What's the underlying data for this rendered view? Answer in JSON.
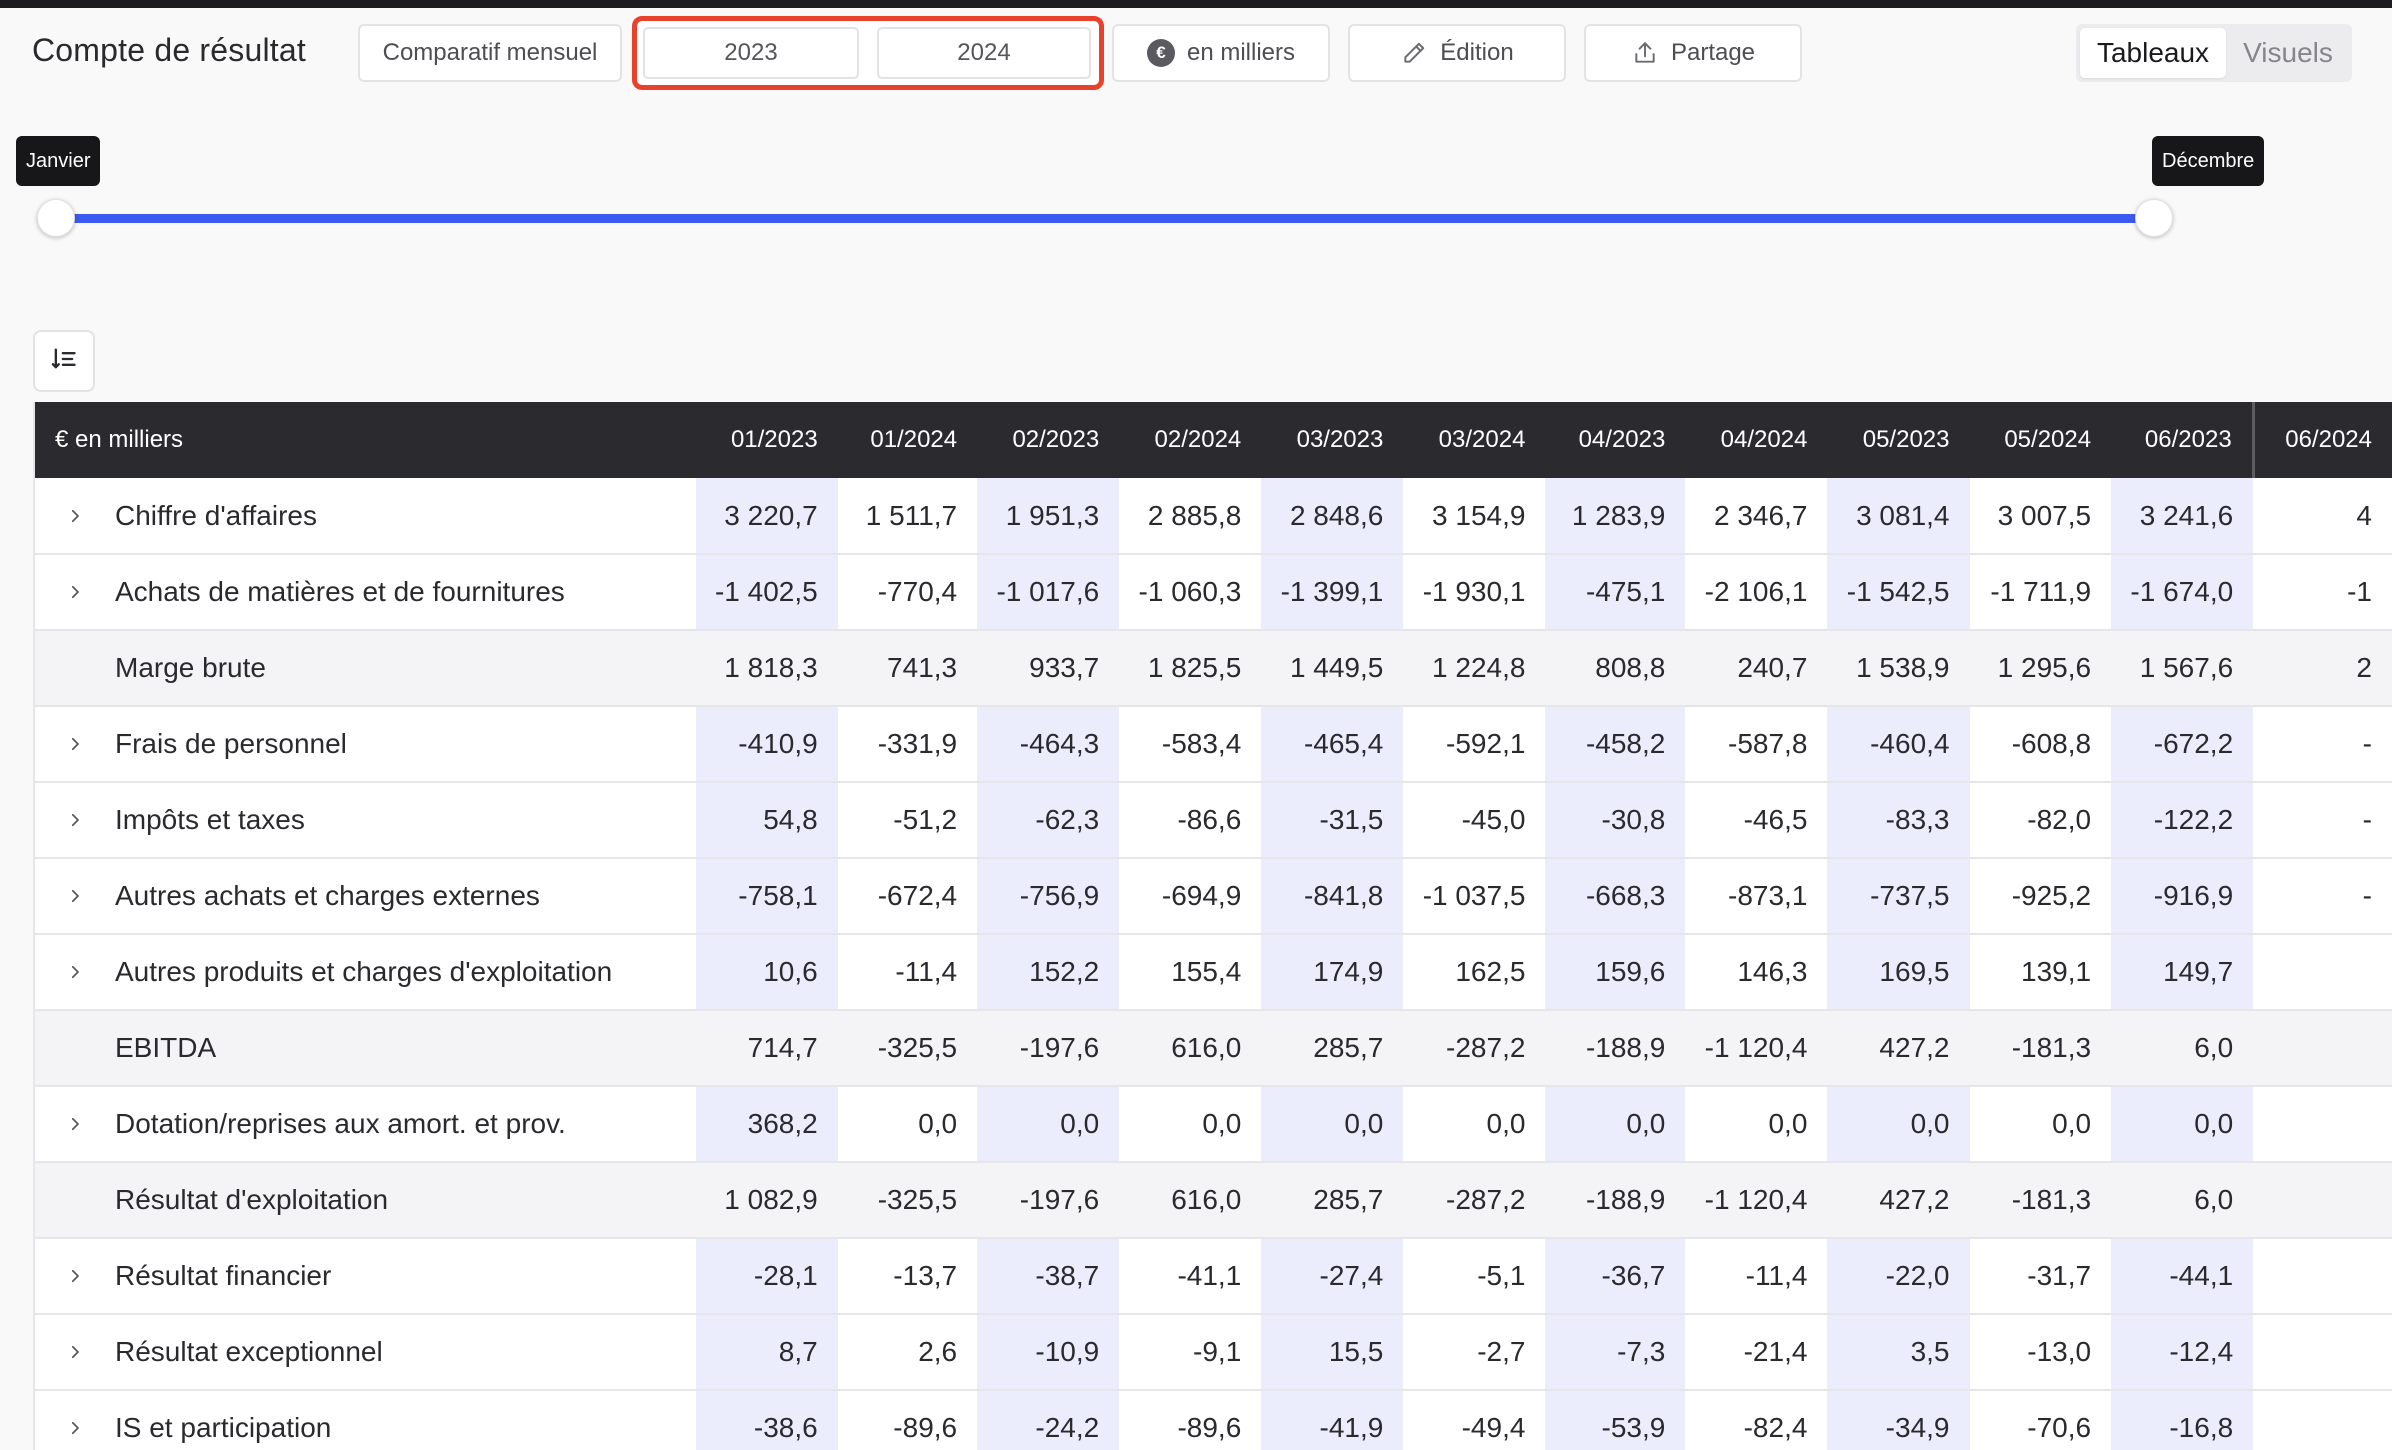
{
  "header": {
    "title": "Compte de résultat",
    "comparatif_label": "Comparatif mensuel",
    "year_a": "2023",
    "year_b": "2024",
    "unit_label": "en milliers",
    "unit_icon": "euro-icon",
    "edit_label": "Édition",
    "share_label": "Partage",
    "view_tabs": [
      "Tableaux",
      "Visuels"
    ],
    "active_view": "Tableaux"
  },
  "slider": {
    "start_label": "Janvier",
    "end_label": "Décembre"
  },
  "colors": {
    "highlight_border": "#e8412c",
    "slider_track": "#3d5af1",
    "header_bg": "#2b2b2f",
    "col_2023_bg": "#ebedfc"
  },
  "table": {
    "corner_label": "€ en milliers",
    "columns": [
      "01/2023",
      "01/2024",
      "02/2023",
      "02/2024",
      "03/2023",
      "03/2024",
      "04/2023",
      "04/2024",
      "05/2023",
      "05/2024",
      "06/2023",
      "06/2024"
    ],
    "rows": [
      {
        "label": "Chiffre d'affaires",
        "expandable": true,
        "subtotal": false,
        "values": [
          "3 220,7",
          "1 511,7",
          "1 951,3",
          "2 885,8",
          "2 848,6",
          "3 154,9",
          "1 283,9",
          "2 346,7",
          "3 081,4",
          "3 007,5",
          "3 241,6",
          "4"
        ]
      },
      {
        "label": "Achats de matières et de fournitures",
        "expandable": true,
        "subtotal": false,
        "values": [
          "-1 402,5",
          "-770,4",
          "-1 017,6",
          "-1 060,3",
          "-1 399,1",
          "-1 930,1",
          "-475,1",
          "-2 106,1",
          "-1 542,5",
          "-1 711,9",
          "-1 674,0",
          "-1"
        ]
      },
      {
        "label": "Marge brute",
        "expandable": false,
        "subtotal": true,
        "values": [
          "1 818,3",
          "741,3",
          "933,7",
          "1 825,5",
          "1 449,5",
          "1 224,8",
          "808,8",
          "240,7",
          "1 538,9",
          "1 295,6",
          "1 567,6",
          "2"
        ]
      },
      {
        "label": "Frais de personnel",
        "expandable": true,
        "subtotal": false,
        "values": [
          "-410,9",
          "-331,9",
          "-464,3",
          "-583,4",
          "-465,4",
          "-592,1",
          "-458,2",
          "-587,8",
          "-460,4",
          "-608,8",
          "-672,2",
          "-"
        ]
      },
      {
        "label": "Impôts et taxes",
        "expandable": true,
        "subtotal": false,
        "values": [
          "54,8",
          "-51,2",
          "-62,3",
          "-86,6",
          "-31,5",
          "-45,0",
          "-30,8",
          "-46,5",
          "-83,3",
          "-82,0",
          "-122,2",
          "-"
        ]
      },
      {
        "label": "Autres achats et charges externes",
        "expandable": true,
        "subtotal": false,
        "values": [
          "-758,1",
          "-672,4",
          "-756,9",
          "-694,9",
          "-841,8",
          "-1 037,5",
          "-668,3",
          "-873,1",
          "-737,5",
          "-925,2",
          "-916,9",
          "-"
        ]
      },
      {
        "label": "Autres produits et charges d'exploitation",
        "expandable": true,
        "subtotal": false,
        "values": [
          "10,6",
          "-11,4",
          "152,2",
          "155,4",
          "174,9",
          "162,5",
          "159,6",
          "146,3",
          "169,5",
          "139,1",
          "149,7",
          ""
        ]
      },
      {
        "label": "EBITDA",
        "expandable": false,
        "subtotal": true,
        "values": [
          "714,7",
          "-325,5",
          "-197,6",
          "616,0",
          "285,7",
          "-287,2",
          "-188,9",
          "-1 120,4",
          "427,2",
          "-181,3",
          "6,0",
          ""
        ]
      },
      {
        "label": "Dotation/reprises aux amort. et prov.",
        "expandable": true,
        "subtotal": false,
        "values": [
          "368,2",
          "0,0",
          "0,0",
          "0,0",
          "0,0",
          "0,0",
          "0,0",
          "0,0",
          "0,0",
          "0,0",
          "0,0",
          ""
        ]
      },
      {
        "label": "Résultat d'exploitation",
        "expandable": false,
        "subtotal": true,
        "values": [
          "1 082,9",
          "-325,5",
          "-197,6",
          "616,0",
          "285,7",
          "-287,2",
          "-188,9",
          "-1 120,4",
          "427,2",
          "-181,3",
          "6,0",
          ""
        ]
      },
      {
        "label": "Résultat financier",
        "expandable": true,
        "subtotal": false,
        "values": [
          "-28,1",
          "-13,7",
          "-38,7",
          "-41,1",
          "-27,4",
          "-5,1",
          "-36,7",
          "-11,4",
          "-22,0",
          "-31,7",
          "-44,1",
          ""
        ]
      },
      {
        "label": "Résultat exceptionnel",
        "expandable": true,
        "subtotal": false,
        "values": [
          "8,7",
          "2,6",
          "-10,9",
          "-9,1",
          "15,5",
          "-2,7",
          "-7,3",
          "-21,4",
          "3,5",
          "-13,0",
          "-12,4",
          ""
        ]
      },
      {
        "label": "IS et participation",
        "expandable": true,
        "subtotal": false,
        "values": [
          "-38,6",
          "-89,6",
          "-24,2",
          "-89,6",
          "-41,9",
          "-49,4",
          "-53,9",
          "-82,4",
          "-34,9",
          "-70,6",
          "-16,8",
          ""
        ]
      }
    ]
  }
}
